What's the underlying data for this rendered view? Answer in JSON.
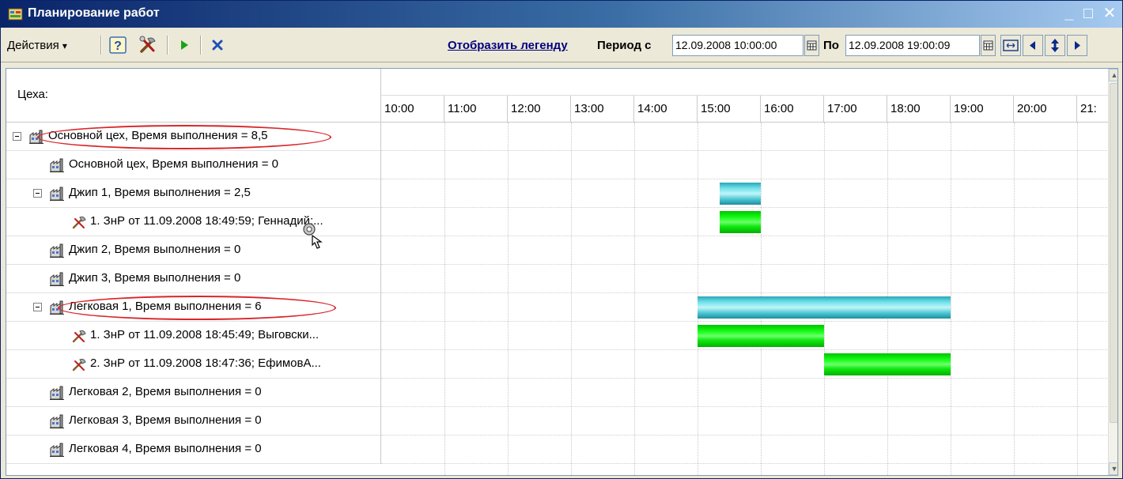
{
  "window": {
    "title": "Планирование работ",
    "minimize": "_",
    "maximize": "□",
    "close": "✕"
  },
  "toolbar": {
    "actions_label": "Действия",
    "actions_arrow": "▾",
    "help_glyph": "?",
    "show_legend": "Отобразить легенду",
    "period_from_label": "Период с",
    "period_from": "12.09.2008 10:00:00",
    "period_to_label": "По",
    "period_to": "12.09.2008 19:00:09"
  },
  "grid": {
    "header_label": "Цеха:",
    "hours": [
      "10:00",
      "11:00",
      "12:00",
      "13:00",
      "14:00",
      "15:00",
      "16:00",
      "17:00",
      "18:00",
      "19:00",
      "20:00",
      "21:"
    ],
    "rows": [
      {
        "label": "Основной цех,  Время выполнения = 8,5",
        "level": 0,
        "expander": true,
        "icon": "workshop-icon",
        "highlighted": true
      },
      {
        "label": "Основной цех,  Время выполнения = 0",
        "level": 1,
        "expander": false,
        "icon": "workshop-icon"
      },
      {
        "label": "Джип 1,  Время выполнения = 2,5",
        "level": 1,
        "expander": true,
        "icon": "workshop-icon"
      },
      {
        "label": "1. ЗнР от 11.09.2008 18:49:59; Геннадий;...",
        "level": 2,
        "expander": false,
        "icon": "work-order-icon"
      },
      {
        "label": "Джип 2,  Время выполнения = 0",
        "level": 1,
        "expander": false,
        "icon": "workshop-icon"
      },
      {
        "label": "Джип 3,  Время выполнения = 0",
        "level": 1,
        "expander": false,
        "icon": "workshop-icon"
      },
      {
        "label": "Легковая 1,  Время выполнения = 6",
        "level": 1,
        "expander": true,
        "icon": "workshop-icon",
        "highlighted": true
      },
      {
        "label": "1. ЗнР от 11.09.2008 18:45:49; Выговски...",
        "level": 2,
        "expander": false,
        "icon": "work-order-icon"
      },
      {
        "label": "2. ЗнР от 11.09.2008 18:47:36; ЕфимовА...",
        "level": 2,
        "expander": false,
        "icon": "work-order-icon"
      },
      {
        "label": "Легковая 2,  Время выполнения = 0",
        "level": 1,
        "expander": false,
        "icon": "workshop-icon"
      },
      {
        "label": "Легковая 3,  Время выполнения = 0",
        "level": 1,
        "expander": false,
        "icon": "workshop-icon"
      },
      {
        "label": "Легковая 4,  Время выполнения = 0",
        "level": 1,
        "expander": false,
        "icon": "workshop-icon"
      }
    ],
    "bars": [
      {
        "row": 2,
        "start_hour": 15.35,
        "end_hour": 16.0,
        "color": "cyan"
      },
      {
        "row": 3,
        "start_hour": 15.35,
        "end_hour": 16.0,
        "color": "green"
      },
      {
        "row": 6,
        "start_hour": 15.0,
        "end_hour": 19.0,
        "color": "cyan"
      },
      {
        "row": 7,
        "start_hour": 15.0,
        "end_hour": 17.0,
        "color": "green"
      },
      {
        "row": 8,
        "start_hour": 17.0,
        "end_hour": 19.0,
        "color": "green"
      }
    ]
  },
  "colors": {
    "bar_cyan": "#4dc6d3",
    "bar_green": "#19ff19",
    "highlight_oval": "#d9262b",
    "link": "#00007f"
  }
}
